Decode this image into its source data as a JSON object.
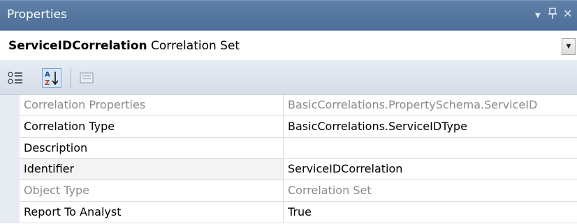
{
  "panel": {
    "title": "Properties",
    "dropdown_glyph": "▼",
    "pin_glyph": "ᚹ",
    "close_glyph": "✕"
  },
  "object_selector": {
    "name": "ServiceIDCorrelation",
    "type": "Correlation Set",
    "arrow": "▼"
  },
  "toolbar": {
    "categorized_icon": "categorized-icon",
    "alphabetical_icon": "alphabetical-icon",
    "property_pages_icon": "property-pages-icon",
    "alphabetical_active": true
  },
  "properties": [
    {
      "name": "Correlation Properties",
      "value": "BasicCorrelations.PropertySchema.ServiceID",
      "readonly": true
    },
    {
      "name": "Correlation Type",
      "value": "BasicCorrelations.ServiceIDType",
      "readonly": false
    },
    {
      "name": "Description",
      "value": "",
      "readonly": false
    },
    {
      "name": "Identifier",
      "value": "ServiceIDCorrelation",
      "readonly": false
    },
    {
      "name": "Object Type",
      "value": "Correlation Set",
      "readonly": true
    },
    {
      "name": "Report To Analyst",
      "value": "True",
      "readonly": false
    }
  ]
}
